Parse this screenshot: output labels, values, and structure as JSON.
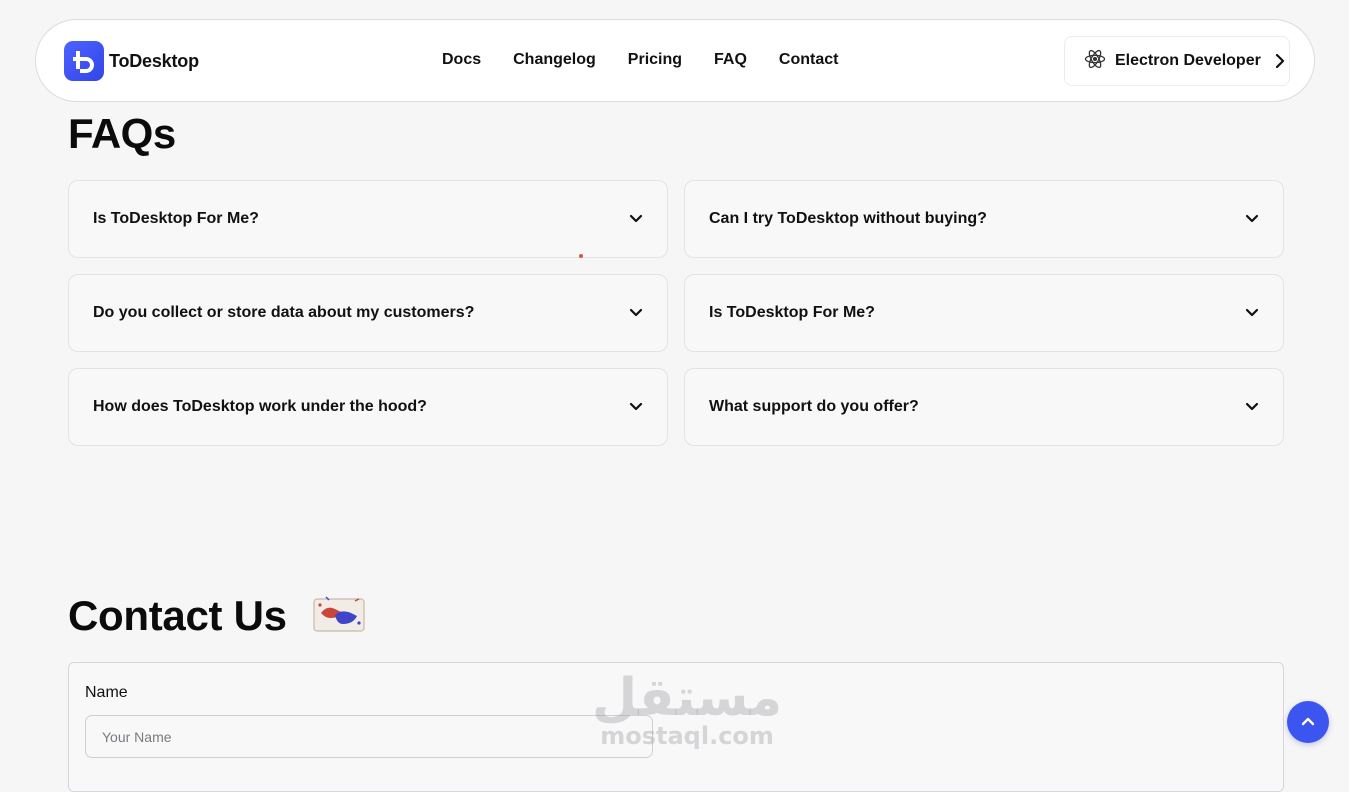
{
  "header": {
    "brand": "ToDesktop",
    "nav": [
      "Docs",
      "Changelog",
      "Pricing",
      "FAQ",
      "Contact"
    ],
    "cta_label": "Electron Developer",
    "cta_icon": "electron-atom-icon"
  },
  "faq": {
    "title": "FAQs",
    "items": [
      "Is ToDesktop For Me?",
      "Can I try ToDesktop without buying?",
      "Do you collect or store data about my customers?",
      "Is ToDesktop For Me?",
      "How does ToDesktop work under the hood?",
      "What support do you offer?"
    ]
  },
  "contact": {
    "title": "Contact Us",
    "title_icon": "handshake-icon",
    "name_label": "Name",
    "name_placeholder": "Your Name",
    "name_value": ""
  },
  "watermark": {
    "arabic": "مستقل",
    "latin": "mostaql.com"
  },
  "colors": {
    "accent": "#3d55f0",
    "background": "#f6f6f7",
    "card": "#f8f8f9",
    "border": "#e3e3e6"
  }
}
